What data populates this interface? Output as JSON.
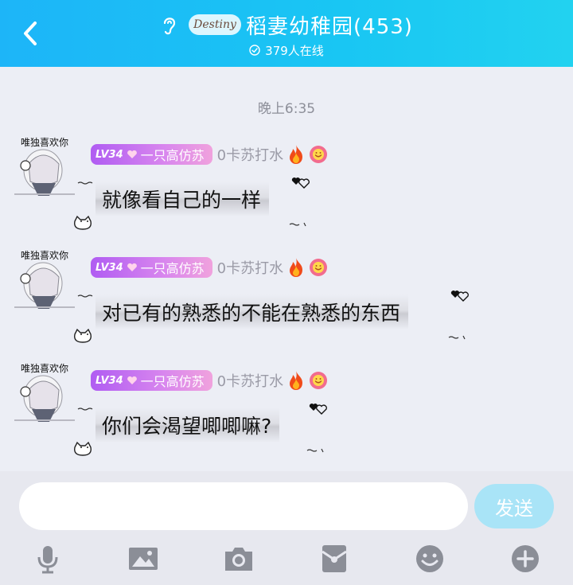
{
  "header": {
    "logo_text": "Destiny",
    "title": "稻妻幼稚园(453)",
    "online": "379人在线"
  },
  "timestamp": "晚上6:35",
  "messages": [
    {
      "avatar_tag": "唯独喜欢你",
      "level": "LV34",
      "title": "一只高仿苏",
      "nickname": "0卡苏打水",
      "text": "就像看自己的一样"
    },
    {
      "avatar_tag": "唯独喜欢你",
      "level": "LV34",
      "title": "一只高仿苏",
      "nickname": "0卡苏打水",
      "text": "对已有的熟悉的不能在熟悉的东西"
    },
    {
      "avatar_tag": "唯独喜欢你",
      "level": "LV34",
      "title": "一只高仿苏",
      "nickname": "0卡苏打水",
      "text": "你们会渴望唧唧嘛?"
    }
  ],
  "input": {
    "placeholder": "",
    "send_label": "发送"
  },
  "toolbar": {
    "icons": [
      "mic-icon",
      "image-icon",
      "camera-icon",
      "red-packet-icon",
      "emoji-icon",
      "plus-icon"
    ]
  },
  "colors": {
    "header_start": "#1db5f8",
    "header_end": "#22d2f0",
    "badge_purple": "#b05cf2",
    "send_button": "#a9e4f7",
    "toolbar_icon": "#8b8e97"
  }
}
